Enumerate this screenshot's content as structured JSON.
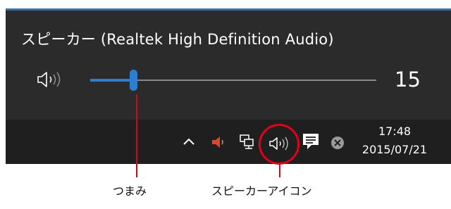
{
  "flyout": {
    "device_name": "スピーカー (Realtek High Definition Audio)",
    "volume_value": "15",
    "volume_level_percent": 15,
    "accent_color": "#2d7dd2",
    "background_color": "#2b2b2b"
  },
  "taskbar": {
    "icons": [
      "chevron-up-icon",
      "red-speaker-icon",
      "network-icon",
      "speaker-icon",
      "action-center-icon",
      "close-circle-icon"
    ],
    "time": "17:48",
    "date": "2015/07/21",
    "background_color": "#1f1f1f"
  },
  "callouts": {
    "knob_label": "つまみ",
    "speaker_icon_label": "スピーカーアイコン",
    "color": "#e0001b"
  }
}
